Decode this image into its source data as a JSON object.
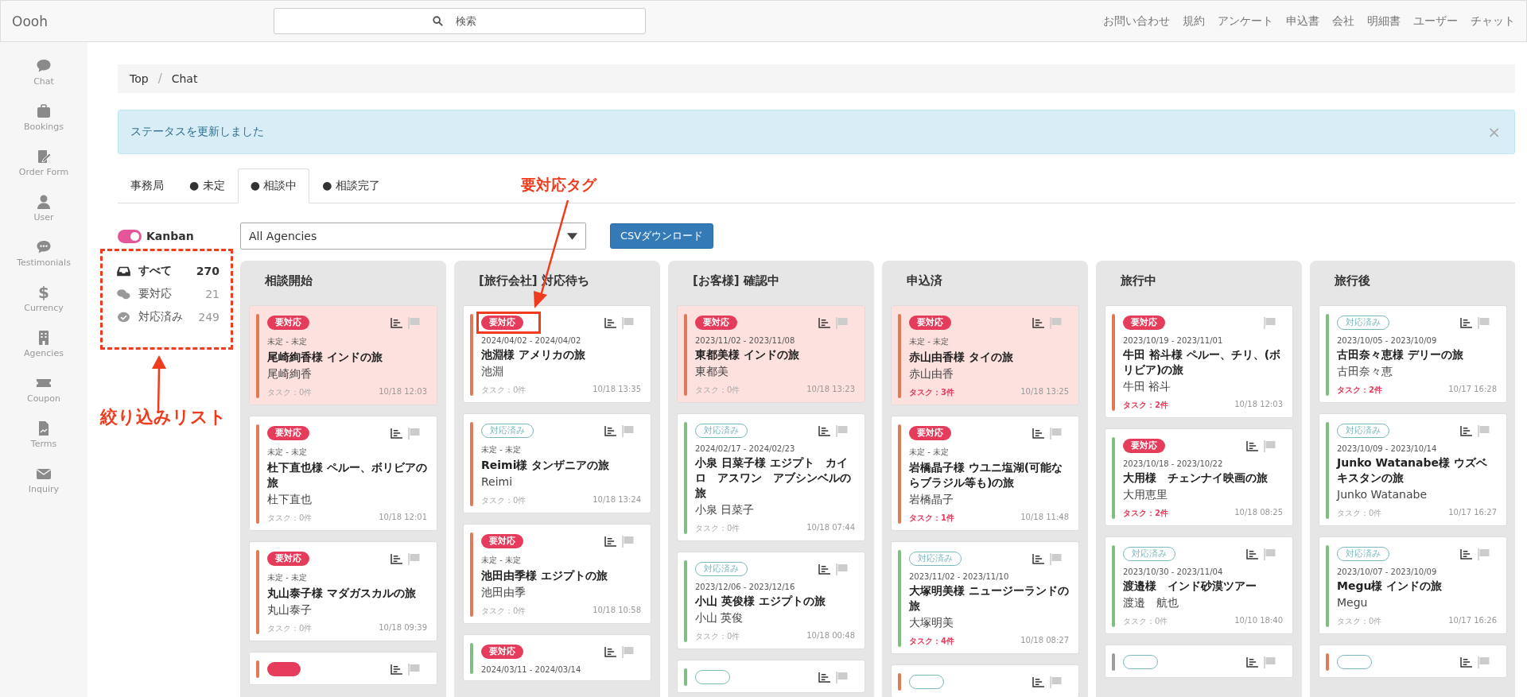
{
  "topbar": {
    "brand": "Oooh",
    "search": {
      "placeholder": "検索"
    },
    "links": [
      "お問い合わせ",
      "規約",
      "アンケート",
      "申込書",
      "会社",
      "明細書",
      "ユーザー",
      "チャット"
    ]
  },
  "sidebar": {
    "items": [
      {
        "label": "Chat"
      },
      {
        "label": "Bookings"
      },
      {
        "label": "Order Form"
      },
      {
        "label": "User"
      },
      {
        "label": "Testimonials"
      },
      {
        "glyph": "$",
        "label": "Currency"
      },
      {
        "label": "Agencies"
      },
      {
        "label": "Coupon"
      },
      {
        "label": "Terms"
      },
      {
        "label": "Inquiry"
      }
    ]
  },
  "breadcrumb": {
    "items": [
      "Top",
      "Chat"
    ],
    "separator": "/"
  },
  "alert": {
    "text": "ステータスを更新しました",
    "close": "×"
  },
  "tabs": [
    {
      "label": "事務局",
      "selected": false
    },
    {
      "label": "● 未定",
      "selected": false
    },
    {
      "label": "● 相談中",
      "selected": true
    },
    {
      "label": "● 相談完了",
      "selected": false
    }
  ],
  "kanban_toggle": {
    "label": "Kanban",
    "on": true
  },
  "agency_select": {
    "value": "All Agencies"
  },
  "csv_button": "CSVダウンロード",
  "filters": [
    {
      "label": "すべて",
      "count": "270",
      "selected": true
    },
    {
      "label": "要対応",
      "count": "21",
      "selected": false
    },
    {
      "label": "対応済み",
      "count": "249",
      "selected": false
    }
  ],
  "annotations": [
    {
      "label": "要対応タグ"
    },
    {
      "label": "絞り込みリスト"
    }
  ],
  "columns": [
    {
      "title": "相談開始",
      "cards": [
        {
          "tag": {
            "kind": "needs",
            "label": "要対応"
          },
          "dates": "未定 - 未定",
          "title": "尾崎絢香様 インドの旅",
          "customer": "尾崎絢香",
          "task": "タスク：0件",
          "task_alert": false,
          "time": "10/18 12:03",
          "color": "#e07b57",
          "highlighted": true,
          "chart_icon": true
        },
        {
          "tag": {
            "kind": "needs",
            "label": "要対応"
          },
          "dates": "未定 - 未定",
          "title": "杜下直也様 ペルー、ボリビアの旅",
          "customer": "杜下直也",
          "task": "タスク：0件",
          "task_alert": false,
          "time": "10/18 12:01",
          "color": "#e07b57",
          "highlighted": false,
          "chart_icon": true
        },
        {
          "tag": {
            "kind": "needs",
            "label": "要対応"
          },
          "dates": "未定 - 未定",
          "title": "丸山泰子様 マダガスカルの旅",
          "customer": "丸山泰子",
          "task": "タスク：0件",
          "task_alert": false,
          "time": "10/18 09:39",
          "color": "#e07b57",
          "highlighted": false,
          "chart_icon": true
        },
        {
          "tag": {
            "kind": "needs"
          },
          "color": "#e07b57",
          "highlighted": false,
          "chart_icon": true
        }
      ]
    },
    {
      "title": "[旅行会社] 対応待ち",
      "cards": [
        {
          "tag": {
            "kind": "needs",
            "label": "要対応"
          },
          "dates": "2024/04/02 - 2024/04/02",
          "title": "池淵様 アメリカの旅",
          "customer": "池淵",
          "task": "タスク：0件",
          "task_alert": false,
          "time": "10/18 13:35",
          "color": "#e07b57",
          "highlighted": false,
          "chart_icon": true,
          "annotated": true
        },
        {
          "tag": {
            "kind": "done",
            "label": "対応済み"
          },
          "dates": "未定 - 未定",
          "title": "Reimi様 タンザニアの旅",
          "customer": "Reimi",
          "task": "タスク：0件",
          "task_alert": false,
          "time": "10/18 13:24",
          "color": "#e07b57",
          "highlighted": false,
          "chart_icon": true
        },
        {
          "tag": {
            "kind": "needs",
            "label": "要対応"
          },
          "dates": "未定 - 未定",
          "title": "池田由季様 エジプトの旅",
          "customer": "池田由季",
          "task": "タスク：0件",
          "task_alert": false,
          "time": "10/18 10:58",
          "color": "#e07b57",
          "highlighted": false,
          "chart_icon": true
        },
        {
          "tag": {
            "kind": "needs",
            "label": "要対応"
          },
          "dates": "2024/03/11 - 2024/03/14",
          "color": "#7fbf7f",
          "highlighted": false,
          "chart_icon": true
        }
      ]
    },
    {
      "title": "[お客様] 確認中",
      "cards": [
        {
          "tag": {
            "kind": "needs",
            "label": "要対応"
          },
          "dates": "2023/11/02 - 2023/11/08",
          "title": "東都美様 インドの旅",
          "customer": "東都美",
          "task": "タスク：0件",
          "task_alert": false,
          "time": "10/18 13:23",
          "color": "#e07b57",
          "highlighted": true,
          "chart_icon": true
        },
        {
          "tag": {
            "kind": "done",
            "label": "対応済み"
          },
          "dates": "2024/02/17 - 2024/02/23",
          "title": "小泉 日菜子様 エジプト　カイロ　アスワン　アブシンベルの旅",
          "customer": "小泉 日菜子",
          "task": "タスク：0件",
          "task_alert": false,
          "time": "10/18 07:44",
          "color": "#7fbf7f",
          "highlighted": false,
          "chart_icon": true
        },
        {
          "tag": {
            "kind": "done",
            "label": "対応済み"
          },
          "dates": "2023/12/06 - 2023/12/16",
          "title": "小山 英俊様 エジプトの旅",
          "customer": "小山 英俊",
          "task": "タスク：0件",
          "task_alert": false,
          "time": "10/18 00:48",
          "color": "#7fbf7f",
          "highlighted": false,
          "chart_icon": true
        },
        {
          "tag": {
            "kind": "done"
          },
          "color": "#7fbf7f",
          "highlighted": false,
          "chart_icon": true
        }
      ]
    },
    {
      "title": "申込済",
      "cards": [
        {
          "tag": {
            "kind": "needs",
            "label": "要対応"
          },
          "dates": "未定 - 未定",
          "title": "赤山由香様 タイの旅",
          "customer": "赤山由香",
          "task": "タスク：3件",
          "task_alert": true,
          "time": "10/18 13:25",
          "color": "#e07b57",
          "highlighted": true,
          "chart_icon": true
        },
        {
          "tag": {
            "kind": "needs",
            "label": "要対応"
          },
          "dates": "未定 - 未定",
          "title": "岩橋晶子様 ウユニ塩湖(可能ならブラジル等も)の旅",
          "customer": "岩橋晶子",
          "task": "タスク：1件",
          "task_alert": true,
          "time": "10/18 11:48",
          "color": "#e07b57",
          "highlighted": false,
          "chart_icon": true
        },
        {
          "tag": {
            "kind": "done",
            "label": "対応済み"
          },
          "dates": "2023/11/02 - 2023/11/10",
          "title": "大塚明美様 ニュージーランドの旅",
          "customer": "大塚明美",
          "task": "タスク：4件",
          "task_alert": true,
          "time": "10/18 08:27",
          "color": "#7fbf7f",
          "highlighted": false,
          "chart_icon": true
        },
        {
          "tag": {
            "kind": "done"
          },
          "color": "#e07b57",
          "highlighted": false,
          "chart_icon": true
        }
      ]
    },
    {
      "title": "旅行中",
      "cards": [
        {
          "tag": {
            "kind": "needs",
            "label": "要対応"
          },
          "dates": "2023/10/19 - 2023/11/01",
          "title": "牛田 裕斗様 ペルー、チリ、(ボリビア)の旅",
          "customer": "牛田 裕斗",
          "task": "タスク：2件",
          "task_alert": true,
          "time": "10/18 12:03",
          "color": "#e07b57",
          "highlighted": false,
          "chart_icon": false
        },
        {
          "tag": {
            "kind": "needs",
            "label": "要対応"
          },
          "dates": "2023/10/18 - 2023/10/22",
          "title": "大用様　チェンナイ映画の旅",
          "customer": "大用恵里",
          "task": "タスク：2件",
          "task_alert": true,
          "time": "10/18 08:25",
          "color": "#7fbf7f",
          "highlighted": false,
          "chart_icon": true
        },
        {
          "tag": {
            "kind": "done",
            "label": "対応済み"
          },
          "dates": "2023/10/30 - 2023/11/04",
          "title": "渡邉様　インド砂漠ツアー",
          "customer": "渡邉　航也",
          "task": "タスク：0件",
          "task_alert": false,
          "time": "10/10 18:40",
          "color": "#7fbf7f",
          "highlighted": false,
          "chart_icon": true
        },
        {
          "tag": {
            "kind": "done"
          },
          "color": "#9e9e9e",
          "highlighted": false,
          "chart_icon": true
        }
      ]
    },
    {
      "title": "旅行後",
      "cards": [
        {
          "tag": {
            "kind": "done",
            "label": "対応済み"
          },
          "dates": "2023/10/05 - 2023/10/09",
          "title": "古田奈々恵様 デリーの旅",
          "customer": "古田奈々恵",
          "task": "タスク：2件",
          "task_alert": true,
          "time": "10/17 16:28",
          "color": "#7fbf7f",
          "highlighted": false,
          "chart_icon": true
        },
        {
          "tag": {
            "kind": "done",
            "label": "対応済み"
          },
          "dates": "2023/10/09 - 2023/10/14",
          "title": "Junko Watanabe様 ウズベキスタンの旅",
          "customer": "Junko Watanabe",
          "task": "タスク：0件",
          "task_alert": false,
          "time": "10/17 16:27",
          "color": "#7fbf7f",
          "highlighted": false,
          "chart_icon": true
        },
        {
          "tag": {
            "kind": "done",
            "label": "対応済み"
          },
          "dates": "2023/10/07 - 2023/10/09",
          "title": "Megu様 インドの旅",
          "customer": "Megu",
          "task": "タスク：0件",
          "task_alert": false,
          "time": "10/17 16:26",
          "color": "#7fbf7f",
          "highlighted": false,
          "chart_icon": true
        },
        {
          "tag": {
            "kind": "done"
          },
          "color": "#e07b57",
          "highlighted": false,
          "chart_icon": true
        }
      ]
    }
  ]
}
